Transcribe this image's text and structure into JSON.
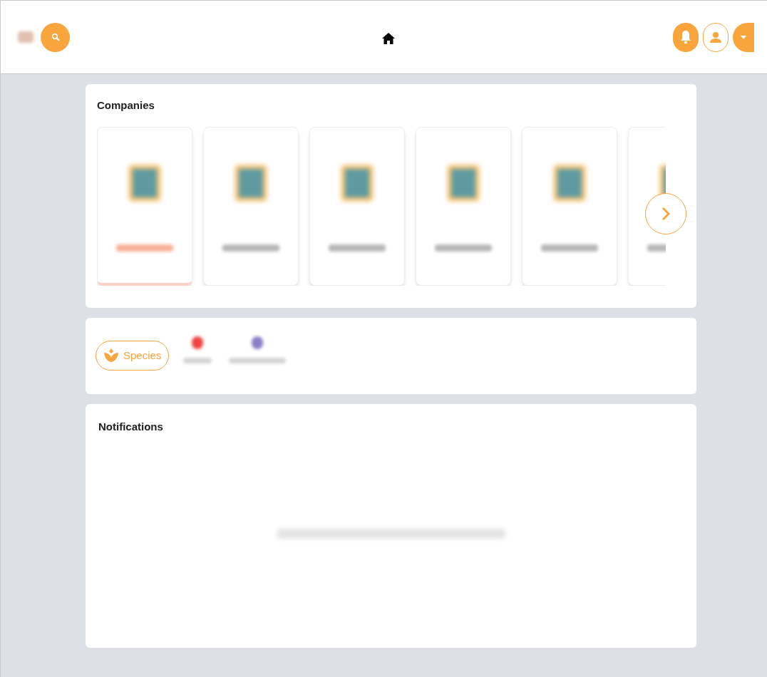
{
  "companies": {
    "title": "Companies",
    "cards": [
      {
        "selected": true
      },
      {
        "selected": false
      },
      {
        "selected": false
      },
      {
        "selected": false
      },
      {
        "selected": false
      },
      {
        "selected": false
      }
    ]
  },
  "filters": [
    {
      "kind": "chip",
      "label": "Species",
      "selected": true
    },
    {
      "kind": "blurred",
      "color": "#ef4444",
      "selected": false
    },
    {
      "kind": "blurred",
      "color": "#8b7fc7",
      "selected": false
    }
  ],
  "notifications": {
    "title": "Notifications"
  }
}
